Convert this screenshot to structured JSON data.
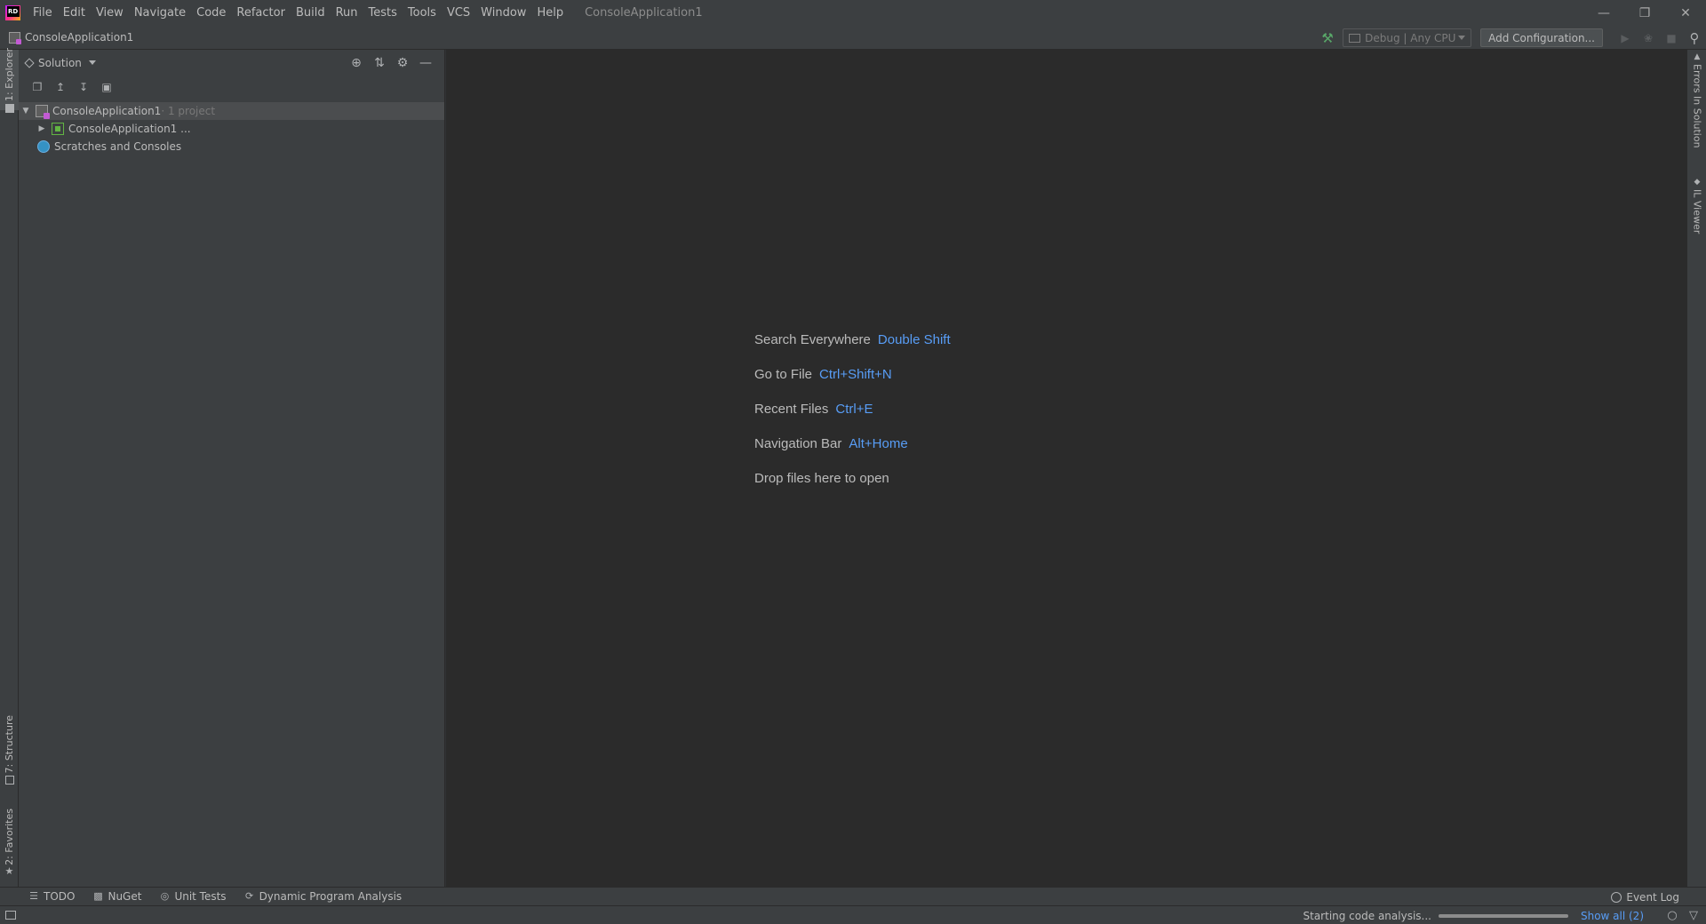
{
  "app": {
    "window_title": "ConsoleApplication1",
    "menu": [
      "File",
      "Edit",
      "View",
      "Navigate",
      "Code",
      "Refactor",
      "Build",
      "Run",
      "Tests",
      "Tools",
      "VCS",
      "Window",
      "Help"
    ]
  },
  "navbar": {
    "breadcrumb": "ConsoleApplication1",
    "config_select": "Debug | Any CPU",
    "add_configuration": "Add Configuration..."
  },
  "left_strip": {
    "explorer_tab": "1: Explorer",
    "structure_tab": "7: Structure",
    "favorites_tab": "2: Favorites"
  },
  "explorer": {
    "title": "Solution",
    "tree": [
      {
        "label": "ConsoleApplication1",
        "note": " · 1 project"
      },
      {
        "label": "ConsoleApplication1 ...",
        "note": ""
      },
      {
        "label": "Scratches and Consoles",
        "note": ""
      }
    ]
  },
  "editor": {
    "hints": [
      {
        "label": "Search Everywhere",
        "key": "Double Shift"
      },
      {
        "label": "Go to File",
        "key": "Ctrl+Shift+N"
      },
      {
        "label": "Recent Files",
        "key": "Ctrl+E"
      },
      {
        "label": "Navigation Bar",
        "key": "Alt+Home"
      },
      {
        "label": "Drop files here to open",
        "key": ""
      }
    ]
  },
  "right_strip": {
    "errors_tab": "Errors In Solution",
    "il_viewer_tab": "IL Viewer"
  },
  "bottom_bar": {
    "tabs": [
      "TODO",
      "NuGet",
      "Unit Tests",
      "Dynamic Program Analysis"
    ],
    "event_log": "Event Log"
  },
  "status": {
    "progress_text": "Starting code analysis...",
    "show_all": "Show all (2)"
  },
  "colors": {
    "accent_link": "#589df6",
    "background": "#2b2b2b",
    "panel": "#3c3f41"
  }
}
